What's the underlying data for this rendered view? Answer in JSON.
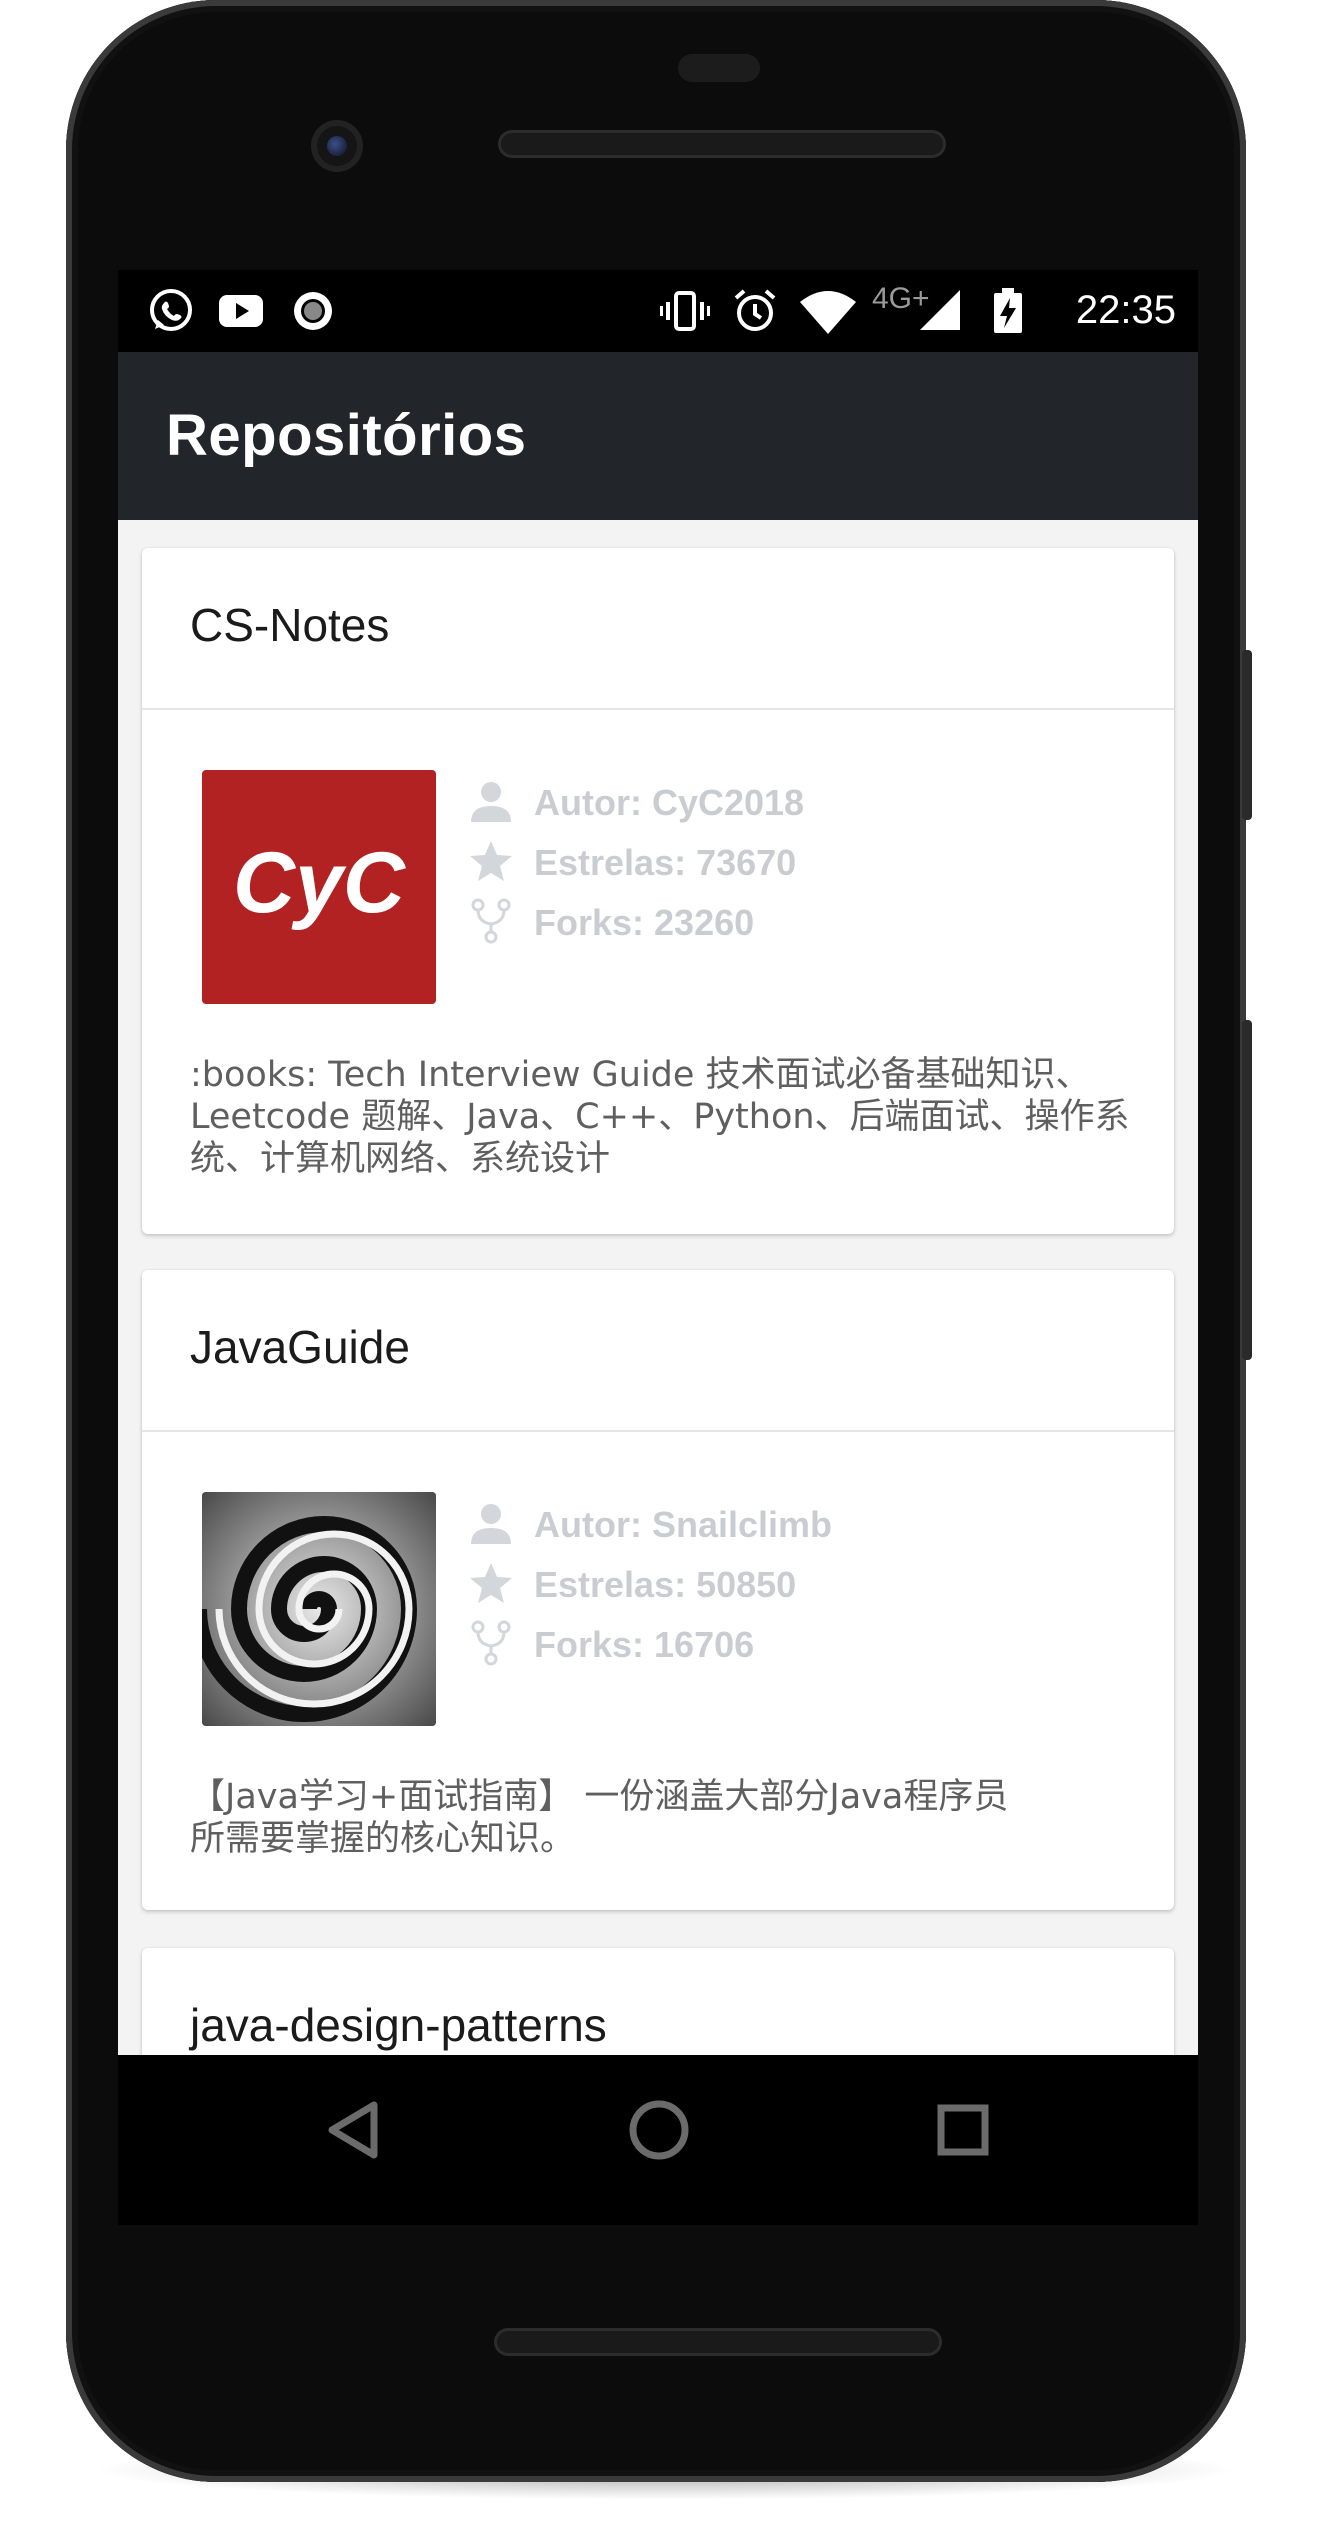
{
  "status_bar": {
    "time": "22:35",
    "network_label": "4G+",
    "left_icons": [
      "whatsapp-icon",
      "youtube-icon",
      "record-icon"
    ],
    "right_icons": [
      "vibrate-icon",
      "alarm-icon",
      "wifi-icon",
      "signal-icon",
      "battery-charging-icon"
    ]
  },
  "app_bar": {
    "title": "Repositórios"
  },
  "repositories": [
    {
      "name": "CS-Notes",
      "author": "Autor: CyC2018",
      "stars": "Estrelas: 73670",
      "forks": "Forks: 23260",
      "avatar_text": "CyC",
      "avatar_color": "#b22222",
      "description_lines": [
        ":books: Tech Interview Guide 技术面试必备基础知识、",
        "Leetcode 题解、Java、C++、Python、后端面试、操作系",
        "统、计算机网络、系统设计"
      ]
    },
    {
      "name": "JavaGuide",
      "author": "Autor: Snailclimb",
      "stars": "Estrelas: 50850",
      "forks": "Forks: 16706",
      "avatar_text": "",
      "avatar_color": "#555555",
      "description_lines": [
        "【Java学习+面试指南】 一份涵盖大部分Java程序员",
        "所需要掌握的核心知识。"
      ]
    },
    {
      "name": "java-design-patterns"
    }
  ],
  "navigation": [
    "back-icon",
    "home-icon",
    "recents-icon"
  ],
  "colors": {
    "app_bar": "#22262b",
    "meta_text": "#c9cdd2",
    "description_text": "#5f5f5f",
    "list_background": "#f3f3f3"
  }
}
